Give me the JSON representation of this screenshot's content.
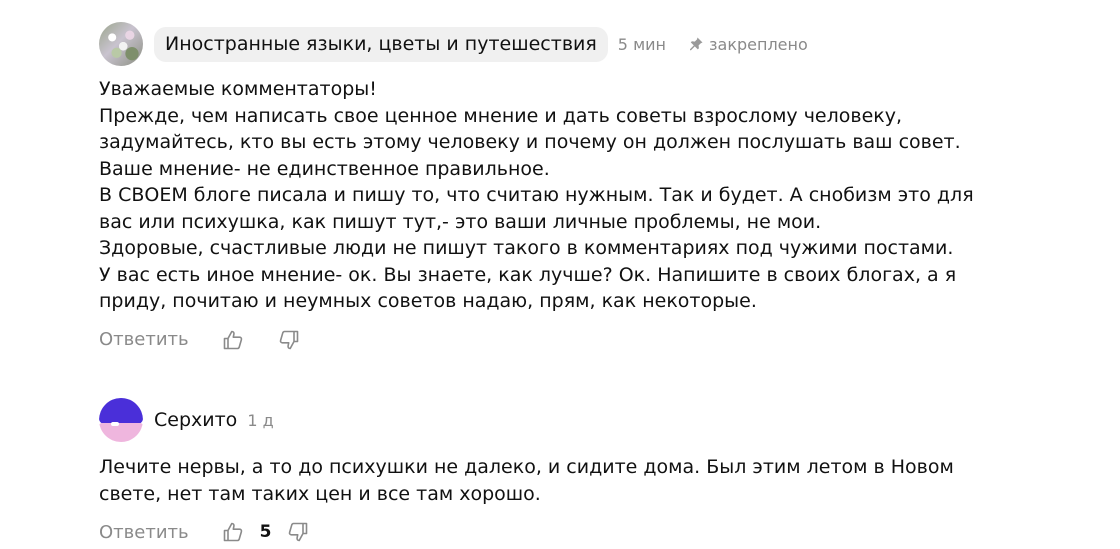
{
  "comments": [
    {
      "author": "Иностранные языки, цветы и путешествия",
      "time": "5 мин",
      "pinned_label": "закреплено",
      "text": "Уважаемые комментаторы!\nПрежде, чем написать свое ценное мнение и дать советы взрослому человеку,\nзадумайтесь, кто вы есть этому человеку и почему он должен послушать ваш совет.\nВаше мнение- не единственное правильное.\nВ СВОЕМ блоге писала и пишу то, что считаю нужным. Так и будет. А снобизм это для\nвас или психушка, как пишут тут,- это ваши личные проблемы, не мои.\nЗдоровые, счастливые люди не пишут такого в комментариях под чужими постами.\nУ вас есть иное мнение- ок. Вы знаете, как лучше? Ок. Напишите в своих блогах, а я\nприду, почитаю и неумных советов надаю, прям, как некоторые.",
      "reply_label": "Ответить"
    },
    {
      "author": "Серхито",
      "time": "1 д",
      "text": "Лечите нервы, а то до психушки не далеко, и сидите дома. Был этим летом в Новом\nсвете, нет там таких цен и все там хорошо.",
      "reply_label": "Ответить",
      "likes": "5"
    }
  ],
  "icons": {
    "pin": "pin-icon",
    "like": "thumbs-up-icon",
    "dislike": "thumbs-down-icon"
  },
  "colors": {
    "muted": "#8a8a8a",
    "chip_bg": "#f0f0f0",
    "brand_purple": "#4a2fd9",
    "brand_pink": "#efb6de"
  }
}
